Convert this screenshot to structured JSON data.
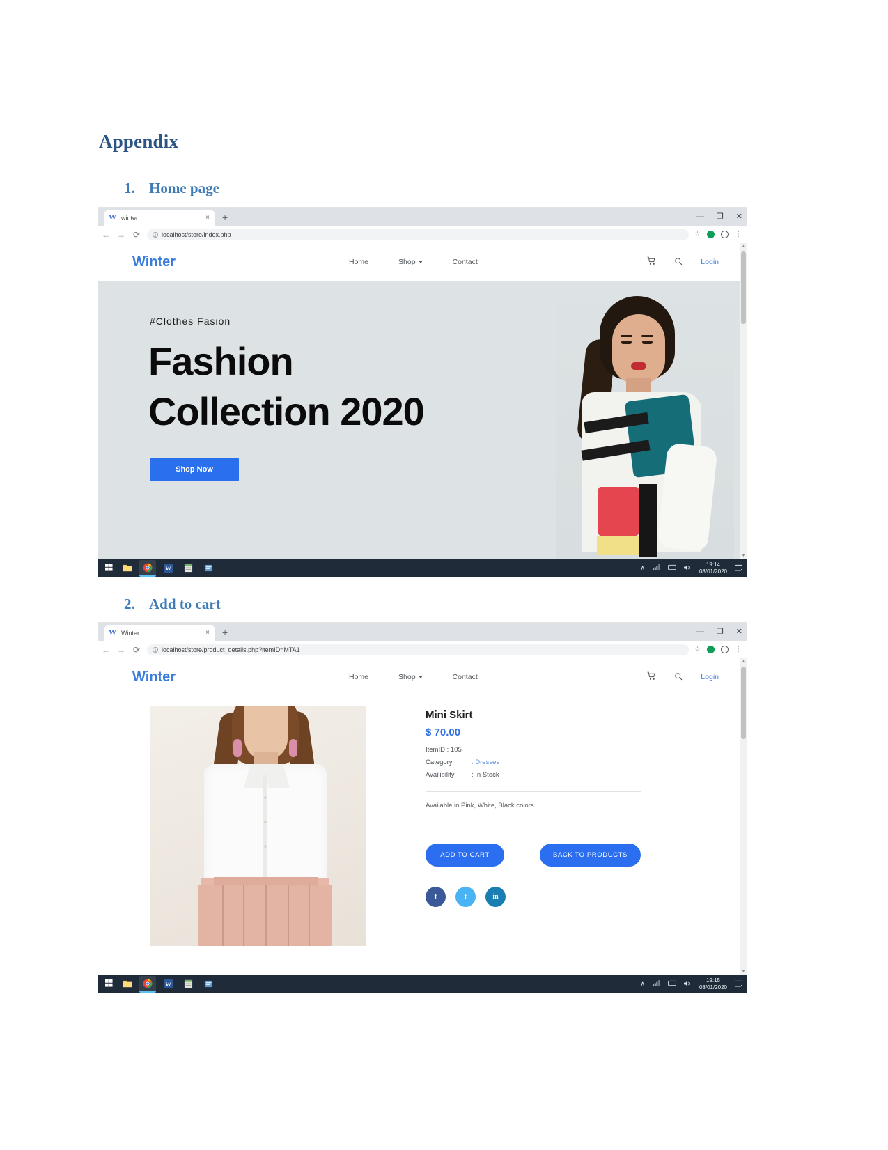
{
  "document": {
    "title": "Appendix",
    "sections": [
      {
        "number": "1.",
        "label": "Home page"
      },
      {
        "number": "2.",
        "label": "Add to cart"
      }
    ]
  },
  "screenshot_home": {
    "browser": {
      "tab": {
        "favicon": "w-letter-icon",
        "title": "winter",
        "close": "×"
      },
      "new_tab": "+",
      "window_controls": {
        "minimize": "—",
        "maximize": "❐",
        "close": "✕"
      },
      "nav": {
        "back": "←",
        "forward": "→",
        "reload": "⟳"
      },
      "omnibox": {
        "info_icon": "i",
        "host": "localhost",
        "path": "/store/index.php",
        "full_url": "localhost/store/index.php"
      },
      "toolbar_right": {
        "bookmark": "☆",
        "extension": "profile-chip-icon",
        "profile": "account-icon",
        "menu": "⋮"
      }
    },
    "site": {
      "logo": "Winter",
      "nav_links": [
        {
          "label": "Home",
          "has_caret": false
        },
        {
          "label": "Shop",
          "has_caret": true
        },
        {
          "label": "Contact",
          "has_caret": false
        }
      ],
      "cart_icon": "Ὥ2",
      "search_icon": "search-icon",
      "login": "Login",
      "hero": {
        "tagline": "#Clothes Fasion",
        "headline_line1": "Fashion",
        "headline_line2": "Collection 2020",
        "cta": "Shop Now"
      }
    },
    "taskbar": {
      "start": "⊞",
      "apps": [
        "file-explorer-icon",
        "chrome-icon",
        "word-icon",
        "notepad-icon",
        "app-icon"
      ],
      "tray": {
        "chevron": "∧",
        "network": "network-icon",
        "keyboard": "keyboard-icon",
        "sound": "speaker-icon",
        "notifications": "notification-icon"
      },
      "time": "19:14",
      "date": "08/01/2020"
    }
  },
  "screenshot_cart": {
    "browser": {
      "tab": {
        "favicon": "w-letter-icon",
        "title": "Winter",
        "close": "×"
      },
      "new_tab": "+",
      "window_controls": {
        "minimize": "—",
        "maximize": "❐",
        "close": "✕"
      },
      "nav": {
        "back": "←",
        "forward": "→",
        "reload": "⟳"
      },
      "omnibox": {
        "info_icon": "i",
        "host": "localhost",
        "path": "/store/product_details.php?itemID=MTA1",
        "full_url": "localhost/store/product_details.php?itemID=MTA1"
      },
      "toolbar_right": {
        "bookmark": "☆",
        "extension": "profile-chip-icon",
        "profile": "account-icon",
        "menu": "⋮"
      }
    },
    "site": {
      "logo": "Winter",
      "nav_links": [
        {
          "label": "Home",
          "has_caret": false
        },
        {
          "label": "Shop",
          "has_caret": true
        },
        {
          "label": "Contact",
          "has_caret": false
        }
      ],
      "login": "Login",
      "product": {
        "name": "Mini Skirt",
        "price": "$ 70.00",
        "item_id_line": "ItemID : 105",
        "rows": [
          {
            "key": "Category",
            "value": ": Dresses",
            "is_link": true
          },
          {
            "key": "Availibility",
            "value": ": In Stock",
            "is_link": false
          }
        ],
        "description": "Available in Pink, White, Black colors",
        "primary_button": "ADD TO CART",
        "secondary_button": "BACK TO PRODUCTS",
        "social": [
          {
            "name": "facebook-icon",
            "glyph": "f",
            "color": "#3b5998"
          },
          {
            "name": "twitter-icon",
            "glyph": "t",
            "color": "#4ab3f4"
          },
          {
            "name": "linkedin-icon",
            "glyph": "in",
            "color": "#1b7eb0"
          }
        ]
      }
    },
    "taskbar": {
      "start": "⊞",
      "apps": [
        "file-explorer-icon",
        "chrome-icon",
        "word-icon",
        "notepad-icon",
        "app-icon"
      ],
      "tray": {
        "chevron": "∧",
        "network": "network-icon",
        "keyboard": "keyboard-icon",
        "sound": "speaker-icon",
        "notifications": "notification-icon"
      },
      "time": "19:15",
      "date": "08/01/2020"
    }
  },
  "colors": {
    "heading_dark": "#2a5484",
    "heading_light": "#3f7bb6",
    "brand_blue": "#3b7ddd",
    "button_blue": "#2b6ff0",
    "hero_bg": "#dde3e4",
    "taskbar": "#1f2b38"
  }
}
